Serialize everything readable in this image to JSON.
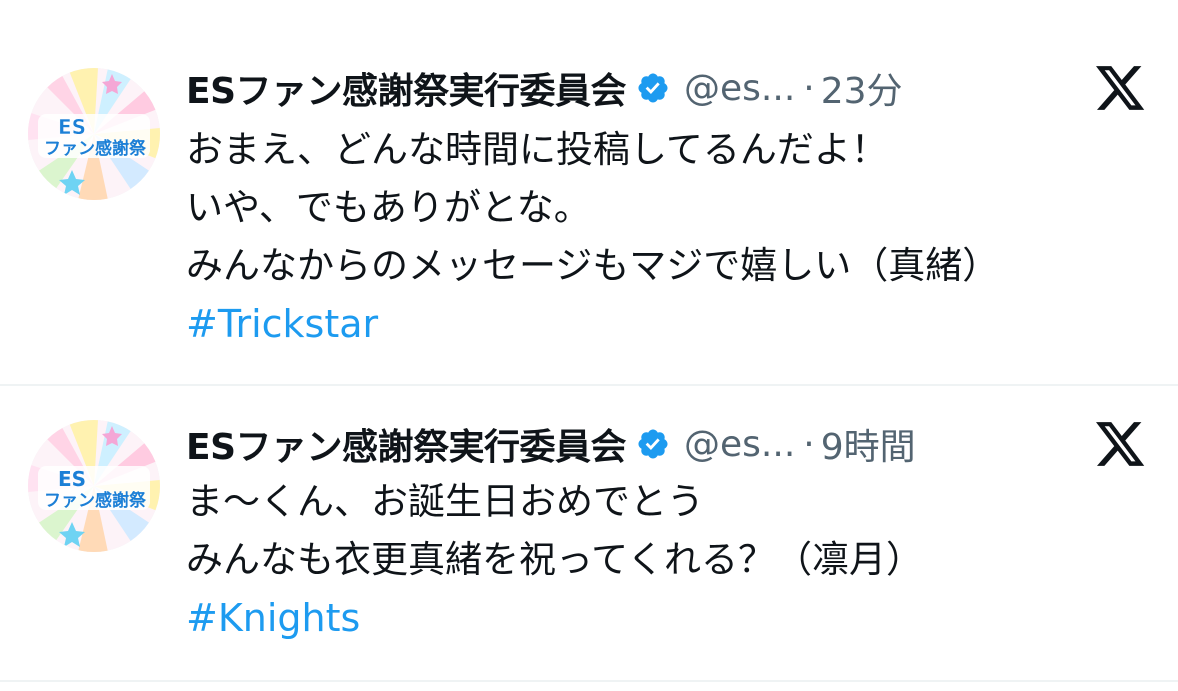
{
  "tweets": [
    {
      "account_name": "ESファン感謝祭実行委員会",
      "handle": "@es...",
      "separator": "·",
      "time": "23分",
      "lines": [
        "おまえ、どんな時間に投稿してるんだよ！",
        "いや、でもありがとな。",
        "みんなからのメッセージもマジで嬉しい（真緒）"
      ],
      "hashtag": "#Trickstar"
    },
    {
      "account_name": "ESファン感謝祭実行委員会",
      "handle": "@es...",
      "separator": "·",
      "time": "9時間",
      "lines": [
        "ま〜くん、お誕生日おめでとう",
        "みんなも衣更真緒を祝ってくれる？（凛月）"
      ],
      "hashtag": "#Knights"
    }
  ],
  "avatar_logo_text": {
    "top": "ES",
    "bottom": "ファン感謝祭"
  },
  "icons": {
    "verified": "verified-badge-icon",
    "platform": "x-logo-icon"
  },
  "colors": {
    "text": "#0f1419",
    "secondary": "#536471",
    "hashtag": "#1d9bf0",
    "verified": "#1d9bf0",
    "divider": "#eff3f4"
  }
}
